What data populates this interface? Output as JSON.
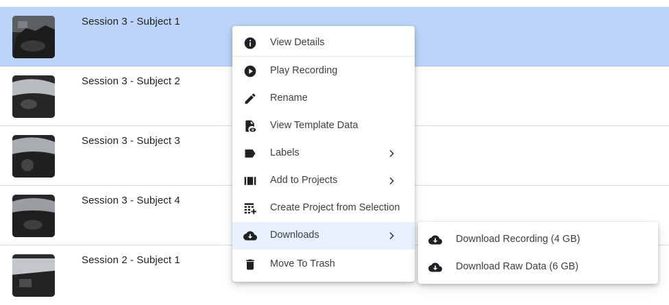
{
  "sessions": [
    {
      "title": "Session 3 - Subject 1",
      "selected": true
    },
    {
      "title": "Session 3 - Subject 2",
      "selected": false
    },
    {
      "title": "Session 3 - Subject 3",
      "selected": false
    },
    {
      "title": "Session 3 - Subject 4",
      "selected": false
    },
    {
      "title": "Session 2 - Subject 1",
      "selected": false
    }
  ],
  "context_menu": {
    "items": [
      {
        "label": "View Details",
        "icon": "info-icon"
      },
      {
        "label": "Play Recording",
        "icon": "play-circle-icon"
      },
      {
        "label": "Rename",
        "icon": "pencil-icon"
      },
      {
        "label": "View Template Data",
        "icon": "file-eye-icon"
      },
      {
        "label": "Labels",
        "icon": "label-tag-icon",
        "submenu": true
      },
      {
        "label": "Add to Projects",
        "icon": "projects-icon",
        "submenu": true
      },
      {
        "label": "Create Project from Selection",
        "icon": "table-add-icon"
      },
      {
        "label": "Downloads",
        "icon": "cloud-download-icon",
        "submenu": true,
        "active": true
      },
      {
        "label": "Move To Trash",
        "icon": "trash-icon"
      }
    ]
  },
  "downloads_submenu": {
    "items": [
      {
        "label": "Download Recording (4 GB)",
        "icon": "cloud-download-icon"
      },
      {
        "label": "Download Raw Data (6 GB)",
        "icon": "cloud-download-icon"
      }
    ]
  },
  "colors": {
    "selected_row": "#bcd4f9",
    "active_menu_item": "#e8f0fe",
    "icon": "#202124"
  }
}
